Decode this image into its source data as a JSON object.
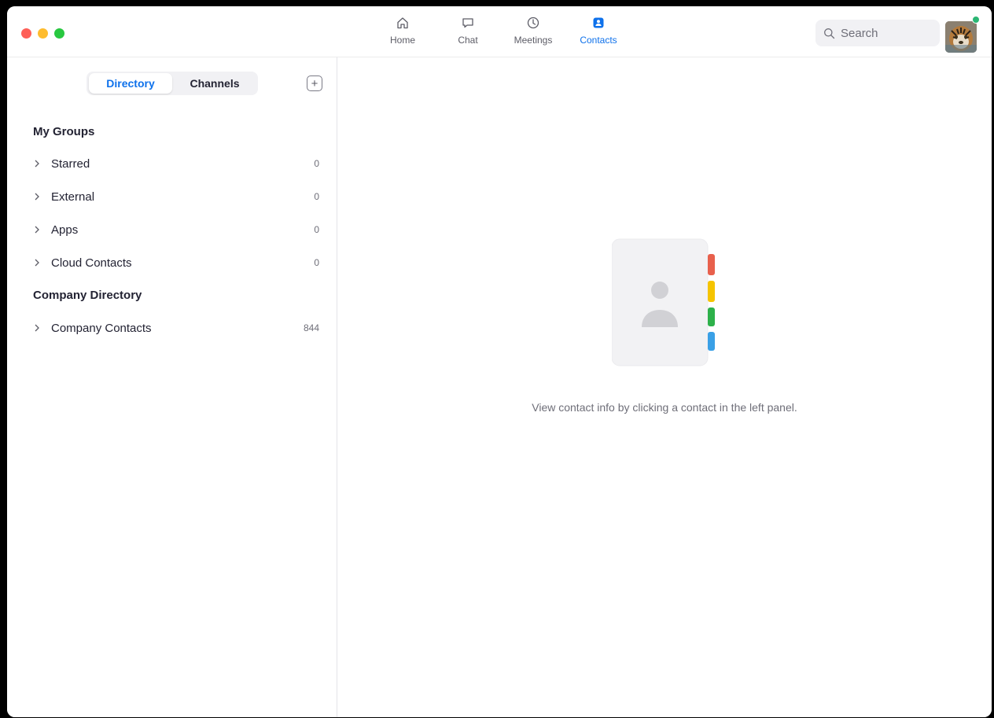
{
  "nav": {
    "items": [
      {
        "label": "Home",
        "icon": "home-icon"
      },
      {
        "label": "Chat",
        "icon": "chat-icon"
      },
      {
        "label": "Meetings",
        "icon": "clock-icon"
      },
      {
        "label": "Contacts",
        "icon": "contacts-icon"
      }
    ],
    "active": "Contacts"
  },
  "search": {
    "placeholder": "Search"
  },
  "sidebar": {
    "tabs": {
      "directory": "Directory",
      "channels": "Channels"
    },
    "add_icon": "plus-icon",
    "my_groups": {
      "title": "My Groups",
      "items": [
        {
          "label": "Starred",
          "count": "0"
        },
        {
          "label": "External",
          "count": "0"
        },
        {
          "label": "Apps",
          "count": "0"
        },
        {
          "label": "Cloud Contacts",
          "count": "0"
        }
      ]
    },
    "company_directory": {
      "title": "Company Directory",
      "items": [
        {
          "label": "Company Contacts",
          "count": "844"
        }
      ]
    }
  },
  "main": {
    "empty_message": "View contact info by clicking a contact in the left panel."
  },
  "colors": {
    "accent": "#0e71eb",
    "tab_red": "#e8604c",
    "tab_yellow": "#f5c400",
    "tab_green": "#2db14a",
    "tab_blue": "#3aa0e6"
  }
}
